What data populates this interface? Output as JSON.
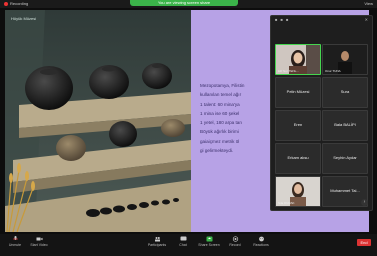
{
  "topbar": {
    "recording_label": "Recording",
    "share_label": "You are viewing screen share",
    "view_label": "View"
  },
  "photo": {
    "caption": "Höyük Müzesi"
  },
  "slide": {
    "lines": [
      "Mezopotamya, Filistin",
      "kullanılan temel ağır",
      "1 talent: 60 mina'ya",
      "1 mina ise 60 şekel",
      "1 yetel, 180 arpa tan",
      "Böyük ağırlık birimi",
      "gaiaiçmez metrik öl",
      "gi gelirmekteydi."
    ]
  },
  "panel": {
    "tiles": [
      {
        "name": "Elif Nur TENL...",
        "video": true
      },
      {
        "name": "Onur TUNA",
        "video": true
      },
      {
        "name": "Pelin Müzesi",
        "video": false
      },
      {
        "name": "Sura",
        "video": false
      },
      {
        "name": "Eren",
        "video": false
      },
      {
        "name": "Bala BALİPI",
        "video": false
      },
      {
        "name": "Erkam aksu",
        "video": false
      },
      {
        "name": "Seyhin Aydar",
        "video": false
      },
      {
        "name": "Sıla DURAK",
        "video": true
      },
      {
        "name": "Muhammet Tal...",
        "video": false
      }
    ]
  },
  "toolbar": {
    "items": [
      {
        "icon": "mic-icon",
        "label": "Unmute"
      },
      {
        "icon": "camera-icon",
        "label": "Start Video"
      },
      {
        "icon": "participants-icon",
        "label": "Participants"
      },
      {
        "icon": "chat-icon",
        "label": "Chat"
      },
      {
        "icon": "share-screen-icon",
        "label": "Share Screen"
      },
      {
        "icon": "record-icon",
        "label": "Record"
      },
      {
        "icon": "reactions-icon",
        "label": "Reactions"
      }
    ],
    "end_label": "End"
  },
  "colors": {
    "slide_bg": "#b7a2e6",
    "share_green": "#3bb44a",
    "end_red": "#dd3333",
    "active_speaker": "#45d54f"
  }
}
